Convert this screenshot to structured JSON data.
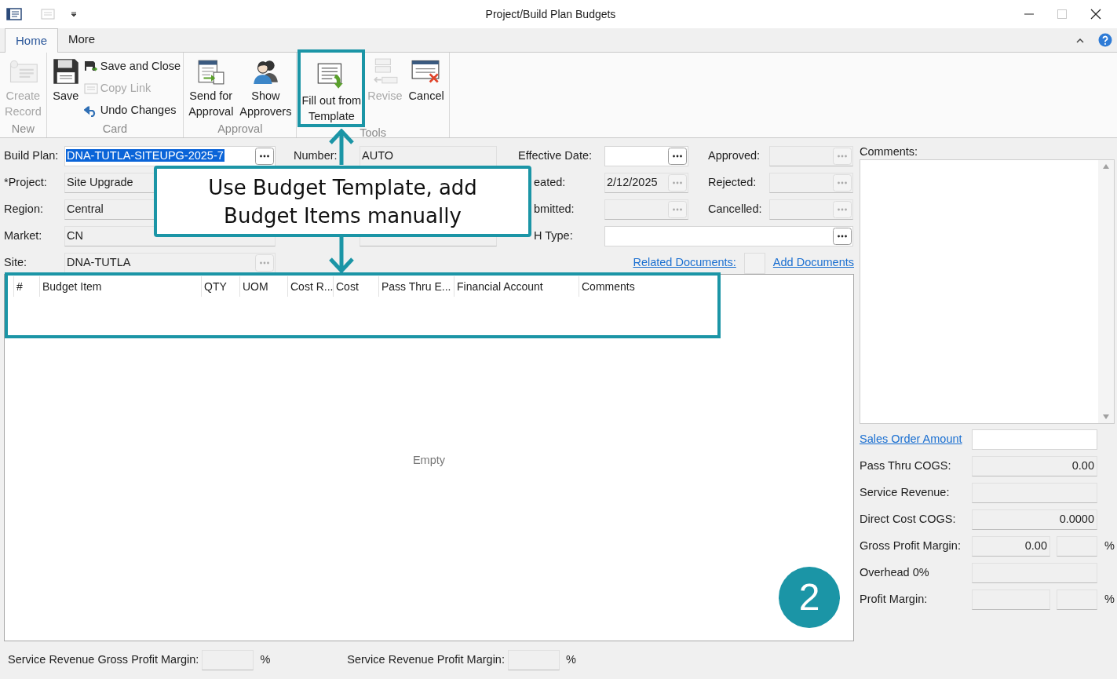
{
  "window": {
    "title": "Project/Build Plan Budgets"
  },
  "ribbon": {
    "tabs": [
      {
        "label": "Home",
        "selected": true
      },
      {
        "label": "More",
        "selected": false
      }
    ],
    "groups": [
      {
        "label": "New",
        "buttons": [
          {
            "label": "Create\nRecord",
            "kind": "large",
            "disabled": true
          }
        ]
      },
      {
        "label": "Card",
        "buttons": [
          {
            "label": "Save",
            "kind": "large",
            "disabled": false
          },
          {
            "label": "Save and Close",
            "kind": "small",
            "disabled": false
          },
          {
            "label": "Copy Link",
            "kind": "small",
            "disabled": true
          },
          {
            "label": "Undo Changes",
            "kind": "small",
            "disabled": false
          }
        ]
      },
      {
        "label": "Approval",
        "buttons": [
          {
            "label": "Send for\nApproval",
            "kind": "large",
            "disabled": false
          },
          {
            "label": "Show\nApprovers",
            "kind": "large",
            "disabled": false
          }
        ]
      },
      {
        "label": "Tools",
        "buttons": [
          {
            "label": "Fill out from\nTemplate",
            "kind": "large",
            "disabled": false,
            "highlighted": true
          },
          {
            "label": "Revise",
            "kind": "large",
            "disabled": true
          },
          {
            "label": "Cancel",
            "kind": "large",
            "disabled": false
          }
        ]
      }
    ]
  },
  "form": {
    "column_1": [
      {
        "label": "Build Plan:",
        "value": "DNA-TUTLA-SITEUPG-2025-7",
        "editable": true,
        "text_selected": true,
        "lookup": {
          "disabled": false
        }
      },
      {
        "label": "*Project:",
        "value": "Site Upgrade",
        "editable": false
      },
      {
        "label": "Region:",
        "value": "Central",
        "editable": false
      },
      {
        "label": "Market:",
        "value": "CN",
        "editable": false
      },
      {
        "label": "Site:",
        "value": "DNA-TUTLA",
        "editable": false,
        "lookup": {
          "disabled": true
        }
      }
    ],
    "number": {
      "label": "Number:",
      "value": "AUTO",
      "editable": false
    },
    "status_field": {
      "editable": false
    },
    "column_3": [
      {
        "label": "Effective Date:",
        "editable": true,
        "lookup": {
          "disabled": false
        }
      },
      {
        "label": "eated:",
        "value": "2/12/2025",
        "editable": false,
        "lookup": {
          "disabled": true
        }
      },
      {
        "label": "bmitted:",
        "editable": false,
        "lookup": {
          "disabled": true
        }
      }
    ],
    "column_4": [
      {
        "label": "Approved:",
        "editable": false,
        "lookup": {
          "disabled": true
        }
      },
      {
        "label": "Rejected:",
        "editable": false,
        "lookup": {
          "disabled": true
        }
      },
      {
        "label": "Cancelled:",
        "editable": false,
        "lookup": {
          "disabled": true
        }
      }
    ],
    "type_field": {
      "label": "H Type:",
      "editable": true,
      "lookup": {
        "disabled": false
      }
    },
    "related_documents_link": "Related Documents:",
    "add_documents_link": "Add Documents"
  },
  "grid": {
    "columns": [
      "#",
      "Budget Item",
      "QTY",
      "UOM",
      "Cost R...",
      "Cost",
      "Pass Thru E...",
      "Financial Account",
      "Comments"
    ],
    "empty_text": "Empty"
  },
  "comments": {
    "label": "Comments:"
  },
  "summary": [
    {
      "label": "Sales Order Amount",
      "kind": "link",
      "editable": true
    },
    {
      "label": "Pass Thru COGS:",
      "kind": "plain",
      "value": "0.00",
      "editable": false
    },
    {
      "label": "Service Revenue:",
      "kind": "plain",
      "editable": false
    },
    {
      "label": "Direct Cost COGS:",
      "kind": "plain",
      "value": "0.0000",
      "editable": false
    },
    {
      "label": "Gross Profit Margin:",
      "kind": "percent",
      "value": "0.00",
      "unit": "%",
      "editable": false
    },
    {
      "label": "Overhead 0%",
      "kind": "plain",
      "editable": false
    },
    {
      "label": "Profit Margin:",
      "kind": "percent",
      "unit": "%",
      "editable": false
    }
  ],
  "footer": [
    {
      "label": "Service Revenue Gross Profit Margin:",
      "unit": "%"
    },
    {
      "label": "Service Revenue Profit Margin:",
      "unit": "%"
    }
  ],
  "callout": {
    "text": "Use Budget Template, add Budget Items manually",
    "step": "2"
  }
}
